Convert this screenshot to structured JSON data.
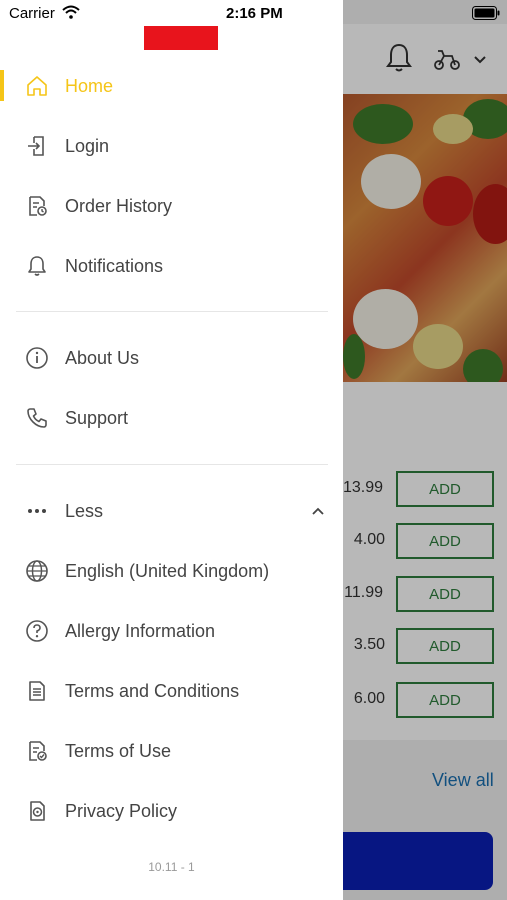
{
  "status_bar": {
    "carrier": "Carrier",
    "time": "2:16 PM"
  },
  "drawer": {
    "logo_color": "#e8141c",
    "accent_color": "#f5c518",
    "group1": [
      {
        "label": "Home",
        "icon": "home-icon",
        "active": true
      },
      {
        "label": "Login",
        "icon": "login-icon"
      },
      {
        "label": "Order History",
        "icon": "order-history-icon"
      },
      {
        "label": "Notifications",
        "icon": "bell-icon"
      }
    ],
    "group2": [
      {
        "label": "About Us",
        "icon": "info-icon"
      },
      {
        "label": "Support",
        "icon": "phone-icon"
      }
    ],
    "group3": [
      {
        "label": "Less",
        "icon": "more-dots-icon"
      },
      {
        "label": "English (United Kingdom)",
        "icon": "globe-icon"
      },
      {
        "label": "Allergy Information",
        "icon": "question-icon"
      },
      {
        "label": "Terms and Conditions",
        "icon": "document-icon"
      },
      {
        "label": "Terms of Use",
        "icon": "document-check-icon"
      },
      {
        "label": "Privacy Policy",
        "icon": "privacy-icon"
      }
    ],
    "version": "10.11 - 1"
  },
  "background": {
    "prices": [
      "13.99",
      "4.00",
      "11.99",
      "3.50",
      "6.00"
    ],
    "add_label": "ADD",
    "view_all": "View all"
  }
}
